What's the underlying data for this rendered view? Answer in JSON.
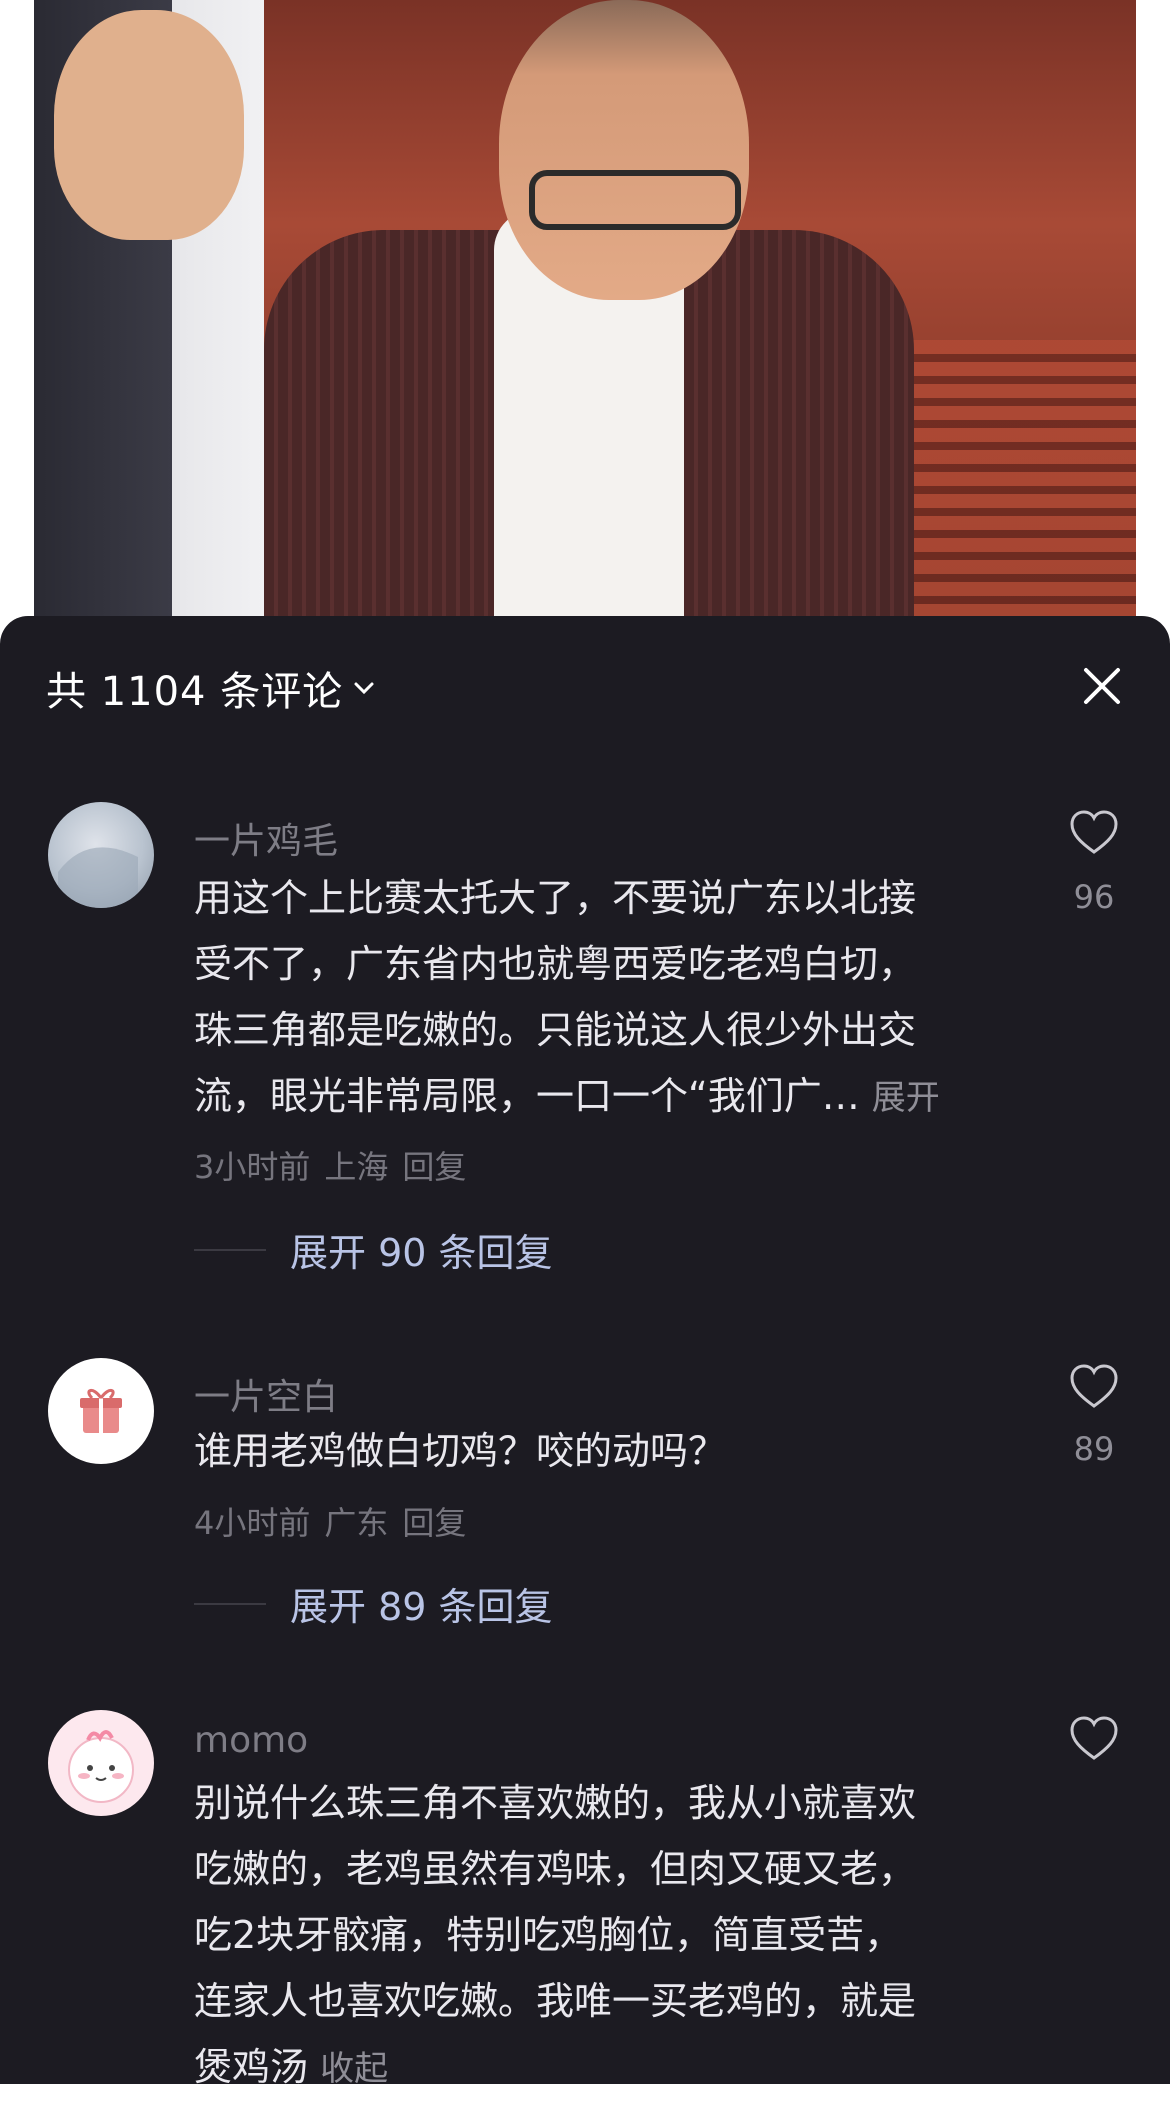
{
  "header": {
    "count_label": "共 1104 条评论"
  },
  "comments": [
    {
      "name": "一片鸡毛",
      "lines": [
        "用这个上比赛太托大了，不要说广东以北接",
        "受不了，广东省内也就粤西爱吃老鸡白切，",
        "珠三角都是吃嫩的。只能说这人很少外出交",
        "流，眼光非常局限，一口一个“我们广…"
      ],
      "expand_label": "展开",
      "time": "3小时前",
      "location": "上海",
      "reply_label": "回复",
      "likes": "96",
      "replies_label": "展开 90 条回复"
    },
    {
      "name": "一片空白",
      "lines": [
        "谁用老鸡做白切鸡？咬的动吗？"
      ],
      "time": "4小时前",
      "location": "广东",
      "reply_label": "回复",
      "likes": "89",
      "replies_label": "展开 89 条回复"
    },
    {
      "name": "momo",
      "lines": [
        "别说什么珠三角不喜欢嫩的，我从小就喜欢",
        "吃嫩的，老鸡虽然有鸡味，但肉又硬又老，",
        "吃2块牙骹痛，特别吃鸡胸位，简直受苦，",
        "连家人也喜欢吃嫩。我唯一买老鸡的，就是",
        "煲鸡汤"
      ],
      "collapse_label": "收起"
    }
  ],
  "colors": {
    "sheet_bg": "#1c1b22",
    "reply_link": "#b9c4e6"
  }
}
